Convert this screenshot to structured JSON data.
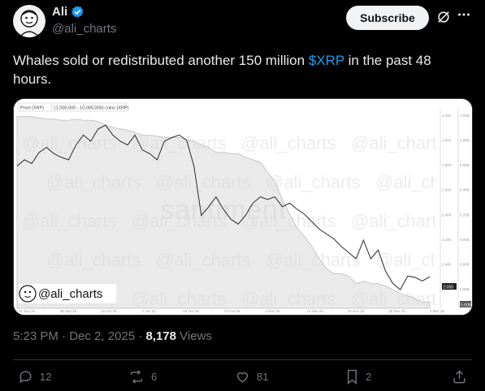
{
  "author": {
    "name": "Ali",
    "handle": "@ali_charts",
    "verified": true
  },
  "header": {
    "subscribe_label": "Subscribe",
    "grok_icon": "grok-icon",
    "more_icon": "more-icon"
  },
  "tweet": {
    "text_before": "Whales sold or redistributed another 150 million ",
    "cashtag": "$XRP",
    "text_after": " in the past 48 hours."
  },
  "meta": {
    "time": "5:23 PM",
    "separator": "·",
    "date": "Dec 2, 2025",
    "views_count": "8,178",
    "views_label": "Views"
  },
  "actions": {
    "replies": "12",
    "reposts": "6",
    "likes": "81",
    "bookmarks": "2"
  },
  "colors": {
    "accent": "#1d9bf0",
    "background": "#000000",
    "text": "#e7e9ea",
    "muted": "#71767b"
  },
  "image": {
    "legend_price": "Price (XRP)",
    "legend_supply": "(1,000,000 - 10,000,000) coins (XRP)",
    "watermark": "santiment",
    "watermark_handle": "@ali_charts",
    "logo_handle": "@ali_charts",
    "x_ticks": [
      "11 Sep 25",
      "28 Sep 25",
      "15 Oct 25",
      "1 Oct 25",
      "18 Oct 25",
      "23 Oct 25",
      "4 Nov 25",
      "13 Nov 25",
      "20 Nov 25",
      "28 Nov 25",
      "2 Dec 25"
    ],
    "price_ticks": [
      "3.200",
      "3.000",
      "2.800",
      "2.600",
      "2.400",
      "2.200",
      "2.000",
      "1.800"
    ],
    "supply_ticks": [
      "7.00B",
      "6.80B",
      "6.60B",
      "6.40B",
      "6.20B",
      "6.00B",
      "5.80B",
      "5.60B"
    ],
    "current_price": "2.055",
    "current_supply": "5.00B"
  },
  "chart_data": {
    "type": "line",
    "title": "",
    "series": [
      {
        "name": "Price (XRP)",
        "values": [
          2.95,
          3.0,
          2.97,
          3.06,
          3.1,
          3.05,
          3.02,
          3.0,
          3.12,
          3.2,
          3.15,
          3.25,
          3.28,
          3.2,
          3.15,
          3.12,
          3.2,
          3.08,
          3.05,
          3.0,
          3.15,
          3.18,
          3.2,
          3.16,
          2.95,
          2.55,
          2.62,
          2.7,
          2.6,
          2.52,
          2.48,
          2.55,
          2.65,
          2.7,
          2.68,
          2.7,
          2.62,
          2.65,
          2.6,
          2.56,
          2.5,
          2.44,
          2.4,
          2.36,
          2.3,
          2.25,
          2.2,
          2.35,
          2.2,
          2.27,
          2.1,
          2.0,
          1.95,
          2.06,
          2.05,
          2.02,
          2.055
        ]
      },
      {
        "name": "(1,000,000 - 10,000,000) coins (XRP)",
        "values": [
          6.95,
          6.95,
          6.95,
          6.94,
          6.93,
          6.93,
          6.92,
          6.92,
          6.93,
          6.92,
          6.92,
          6.91,
          6.88,
          6.86,
          6.85,
          6.84,
          6.82,
          6.8,
          6.8,
          6.79,
          6.78,
          6.78,
          6.78,
          6.76,
          6.75,
          6.72,
          6.7,
          6.66,
          6.66,
          6.65,
          6.65,
          6.62,
          6.6,
          6.58,
          6.5,
          6.42,
          6.28,
          6.16,
          6.05,
          5.98,
          5.9,
          5.8,
          5.72,
          5.68,
          5.68,
          5.66,
          5.6,
          5.62,
          5.6,
          5.6,
          5.58,
          5.55,
          5.52,
          5.5,
          5.48,
          5.45,
          5.45
        ]
      }
    ],
    "x": [
      "11 Sep 25",
      "28 Sep 25",
      "15 Oct 25",
      "1 Oct 25",
      "18 Oct 25",
      "23 Oct 25",
      "4 Nov 25",
      "13 Nov 25",
      "20 Nov 25",
      "28 Nov 25",
      "2 Dec 25"
    ],
    "grid": false
  }
}
